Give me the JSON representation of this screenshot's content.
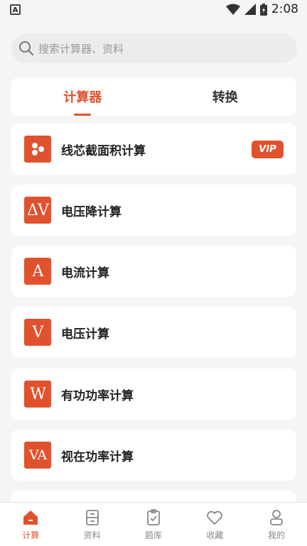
{
  "statusbar": {
    "time": "2:08",
    "app_badge": "A"
  },
  "search": {
    "placeholder": "搜索计算器、资料"
  },
  "tabs": [
    {
      "label": "计算器",
      "active": true
    },
    {
      "label": "转换",
      "active": false
    }
  ],
  "items": [
    {
      "label": "线芯截面积计算",
      "icon": "dots-icon",
      "badge": "VIP"
    },
    {
      "label": "电压降计算",
      "icon_text": "ΔV"
    },
    {
      "label": "电流计算",
      "icon_text": "A"
    },
    {
      "label": "电压计算",
      "icon_text": "V"
    },
    {
      "label": "有功功率计算",
      "icon_text": "W"
    },
    {
      "label": "视在功率计算",
      "icon_text": "VA"
    }
  ],
  "nav": [
    {
      "label": "计算",
      "icon": "home-icon",
      "active": true
    },
    {
      "label": "资料",
      "icon": "folder-icon",
      "active": false
    },
    {
      "label": "题库",
      "icon": "clipboard-icon",
      "active": false
    },
    {
      "label": "收藏",
      "icon": "heart-icon",
      "active": false
    },
    {
      "label": "我的",
      "icon": "user-icon",
      "active": false
    }
  ],
  "colors": {
    "accent": "#e0522d",
    "background": "#f5f5f5"
  }
}
